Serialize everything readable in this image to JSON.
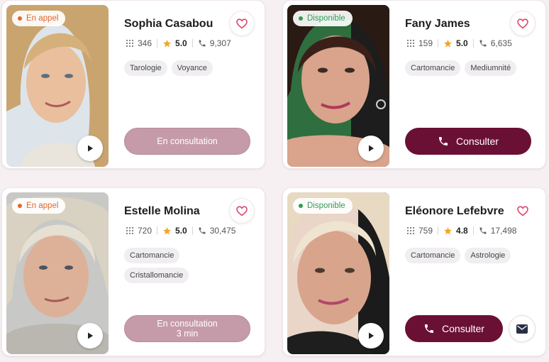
{
  "colors": {
    "in_call": "#e8652a",
    "available": "#2f9d56",
    "consult_button": "#6b1035",
    "busy_button": "#c69ba9",
    "heart": "#e0436a",
    "star": "#f5a623"
  },
  "cards": [
    {
      "status": "En appel",
      "status_type": "in_call",
      "name": "Sophia Casabou",
      "reviews": "346",
      "rating": "5.0",
      "calls": "9,307",
      "tags": [
        "Tarologie",
        "Voyance"
      ],
      "button_line1": "En consultation",
      "button_line2": ""
    },
    {
      "status": "Disponible",
      "status_type": "available",
      "name": "Fany James",
      "reviews": "159",
      "rating": "5.0",
      "calls": "6,635",
      "tags": [
        "Cartomancie",
        "Mediumnité"
      ],
      "button_line1": "Consulter"
    },
    {
      "status": "En appel",
      "status_type": "in_call",
      "name": "Estelle Molina",
      "reviews": "720",
      "rating": "5.0",
      "calls": "30,475",
      "tags": [
        "Cartomancie",
        "Cristallomancie"
      ],
      "button_line1": "En consultation",
      "button_line2": "3 min"
    },
    {
      "status": "Disponible",
      "status_type": "available",
      "name": "Eléonore Lefebvre",
      "reviews": "759",
      "rating": "4.8",
      "calls": "17,498",
      "tags": [
        "Cartomancie",
        "Astrologie"
      ],
      "button_line1": "Consulter"
    }
  ]
}
